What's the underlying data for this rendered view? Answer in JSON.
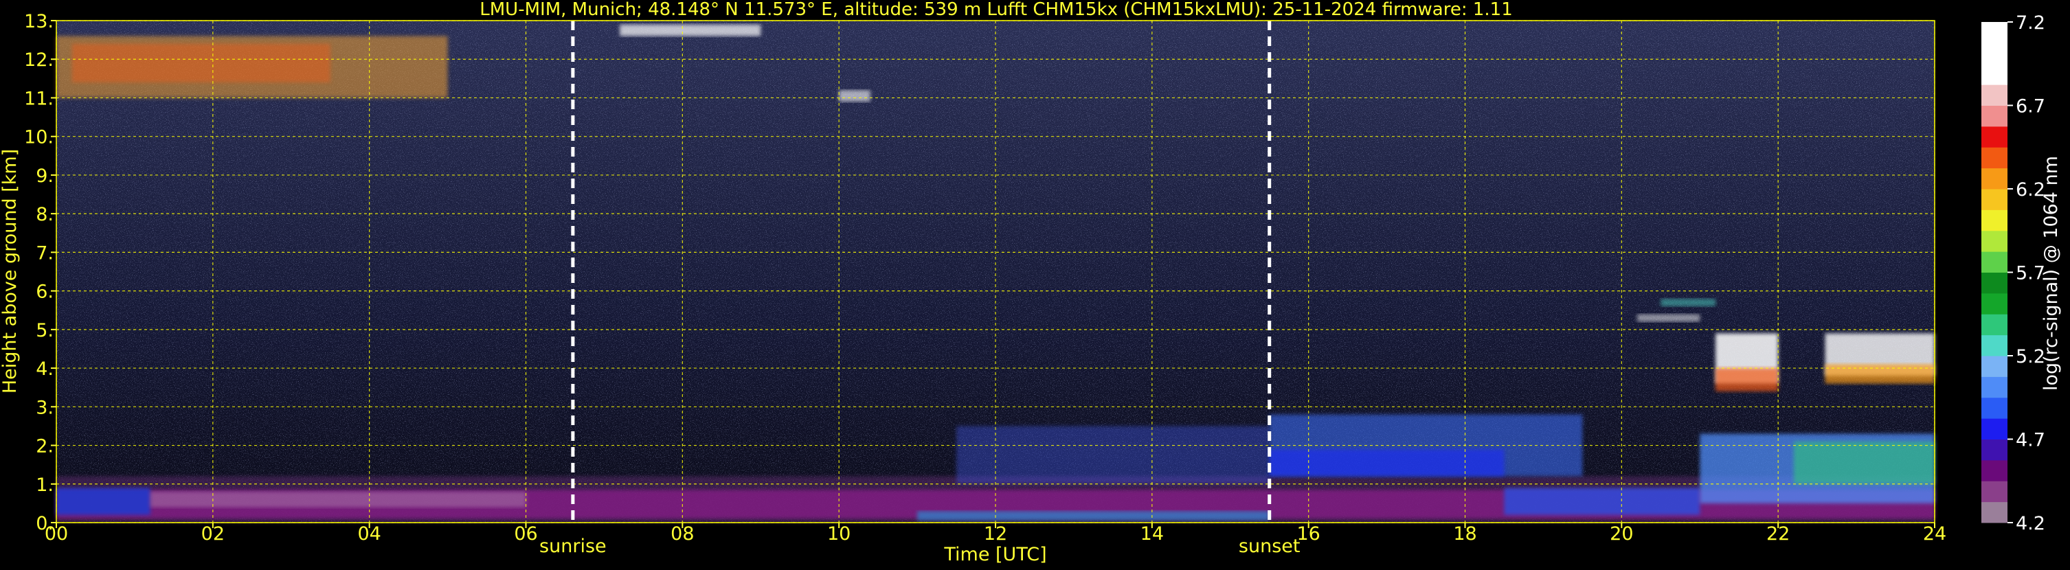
{
  "colors": {
    "background": "#000000",
    "text_yellow": "#ffff33",
    "text_white": "#ffffff",
    "grid": "#ffff00",
    "event_line": "#ffffff"
  },
  "chart_data": {
    "type": "heatmap",
    "title": "LMU-MIM, Munich; 48.148° N 11.573° E, altitude: 539 m    Lufft CHM15kx (CHM15kxLMU): 25-11-2024    firmware: 1.11",
    "xlabel": "Time [UTC]",
    "ylabel": "Height above ground [km]",
    "xlim": [
      0,
      24
    ],
    "ylim": [
      0,
      13
    ],
    "x_ticks": [
      "00",
      "02",
      "04",
      "06",
      "08",
      "10",
      "12",
      "14",
      "16",
      "18",
      "20",
      "22",
      "24"
    ],
    "y_ticks": [
      "0.",
      "1.",
      "2.",
      "3.",
      "4.",
      "5.",
      "6.",
      "7.",
      "8.",
      "9.",
      "10.",
      "11.",
      "12.",
      "13."
    ],
    "grid": true,
    "events": [
      {
        "label": "sunrise",
        "x": 6.6
      },
      {
        "label": "sunset",
        "x": 15.5
      }
    ],
    "colorbar": {
      "label": "log(rc-signal) @ 1064 nm",
      "ticks": [
        "4.2",
        "4.7",
        "5.2",
        "5.7",
        "6.2",
        "6.7",
        "7.2"
      ],
      "range": [
        4.2,
        7.2
      ],
      "colors": [
        "#9a7f9a",
        "#8a3f8a",
        "#6a0a7a",
        "#3f12b0",
        "#1d1df0",
        "#2a5cf5",
        "#4f8cf7",
        "#7ab3f5",
        "#4fd9c8",
        "#2ec77a",
        "#14a62a",
        "#0d8a1e",
        "#5ed14a",
        "#b0e83a",
        "#f0f02a",
        "#f7c51f",
        "#f79a16",
        "#f25a12",
        "#e81010",
        "#f08f8f",
        "#f2c4c4",
        "#ffffff",
        "#ffffff",
        "#ffffff"
      ]
    }
  }
}
